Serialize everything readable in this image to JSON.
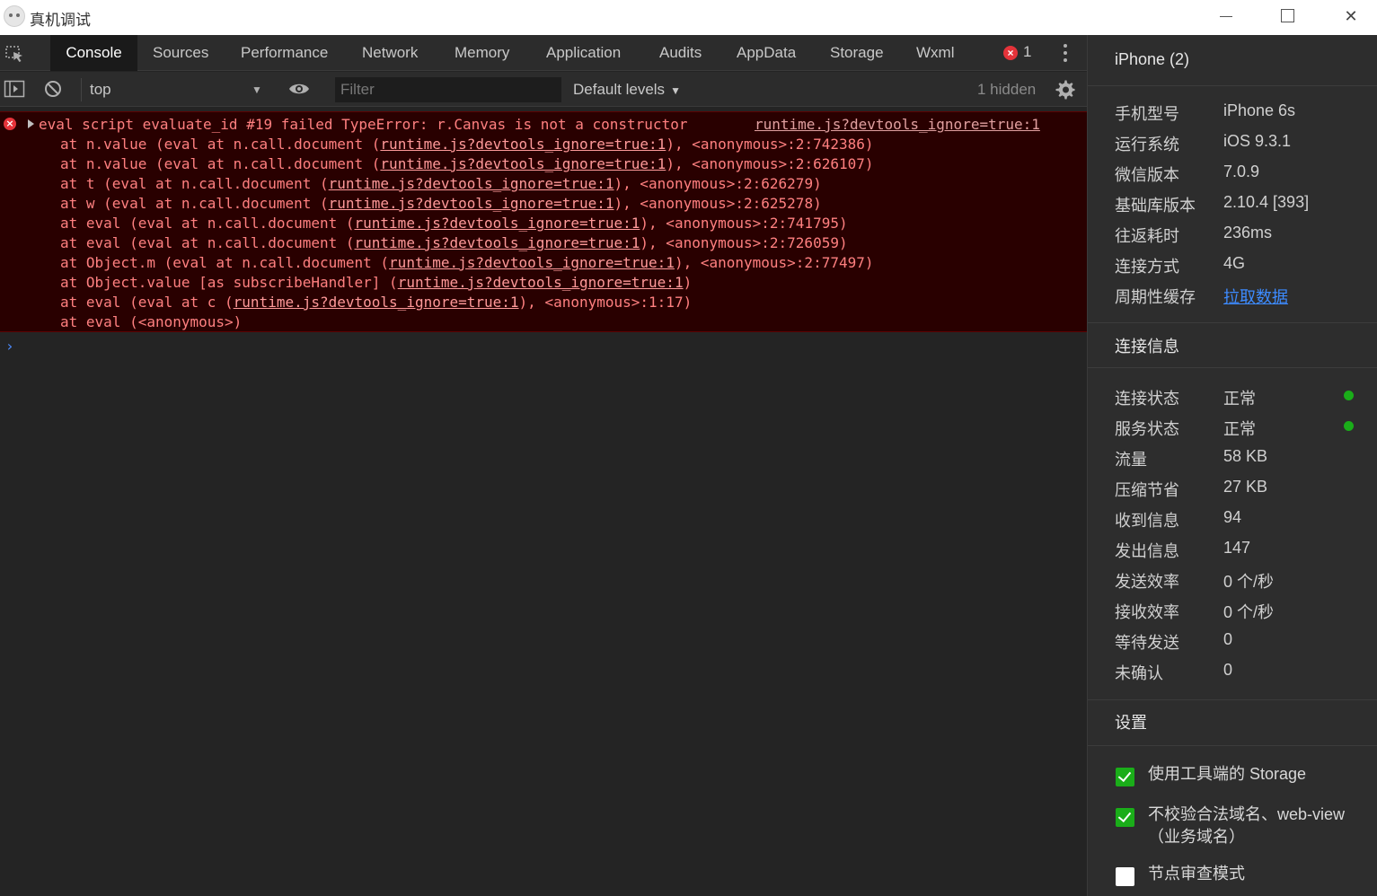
{
  "window": {
    "title": "真机调试",
    "minimize_icon": "minimize-icon",
    "maximize_icon": "maximize-icon",
    "close_glyph": "✕"
  },
  "tabs": [
    {
      "label": "Console",
      "active": true
    },
    {
      "label": "Sources"
    },
    {
      "label": "Performance"
    },
    {
      "label": "Network"
    },
    {
      "label": "Memory"
    },
    {
      "label": "Application"
    },
    {
      "label": "Audits"
    },
    {
      "label": "AppData"
    },
    {
      "label": "Storage"
    },
    {
      "label": "Wxml"
    }
  ],
  "error_badge": {
    "glyph": "×",
    "count": "1"
  },
  "toolbar": {
    "context": "top",
    "filter_placeholder": "Filter",
    "levels": "Default levels",
    "hidden": "1 hidden"
  },
  "console": {
    "error": {
      "icon_glyph": "×",
      "message": "eval script evaluate_id #19 failed TypeError: r.Canvas is not a constructor",
      "source": "runtime.js?devtools_ignore=true:1",
      "stack": [
        {
          "pre": "at n.value (eval at n.call.document (",
          "link": "runtime.js?devtools_ignore=true:1",
          "post": "), <anonymous>:2:742386)"
        },
        {
          "pre": "at n.value (eval at n.call.document (",
          "link": "runtime.js?devtools_ignore=true:1",
          "post": "), <anonymous>:2:626107)"
        },
        {
          "pre": "at t (eval at n.call.document (",
          "link": "runtime.js?devtools_ignore=true:1",
          "post": "), <anonymous>:2:626279)"
        },
        {
          "pre": "at w (eval at n.call.document (",
          "link": "runtime.js?devtools_ignore=true:1",
          "post": "), <anonymous>:2:625278)"
        },
        {
          "pre": "at eval (eval at n.call.document (",
          "link": "runtime.js?devtools_ignore=true:1",
          "post": "), <anonymous>:2:741795)"
        },
        {
          "pre": "at eval (eval at n.call.document (",
          "link": "runtime.js?devtools_ignore=true:1",
          "post": "), <anonymous>:2:726059)"
        },
        {
          "pre": "at Object.m (eval at n.call.document (",
          "link": "runtime.js?devtools_ignore=true:1",
          "post": "), <anonymous>:2:77497)"
        },
        {
          "pre": "at Object.value [as subscribeHandler] (",
          "link": "runtime.js?devtools_ignore=true:1",
          "post": ")"
        },
        {
          "pre": "at eval (eval at c (",
          "link": "runtime.js?devtools_ignore=true:1",
          "post": "), <anonymous>:1:17)"
        },
        {
          "pre": "at eval (<anonymous>)",
          "link": "",
          "post": ""
        }
      ]
    },
    "prompt": "›"
  },
  "side": {
    "device": "iPhone (2)",
    "info": [
      {
        "label": "手机型号",
        "value": "iPhone 6s"
      },
      {
        "label": "运行系统",
        "value": "iOS 9.3.1"
      },
      {
        "label": "微信版本",
        "value": "7.0.9"
      },
      {
        "label": "基础库版本",
        "value": "2.10.4 [393]"
      },
      {
        "label": "往返耗时",
        "value": "236ms"
      },
      {
        "label": "连接方式",
        "value": "4G"
      },
      {
        "label": "周期性缓存",
        "value": "拉取数据",
        "link": true
      }
    ],
    "conn_title": "连接信息",
    "conn": [
      {
        "label": "连接状态",
        "value": "正常",
        "status_dot": true
      },
      {
        "label": "服务状态",
        "value": "正常",
        "status_dot": true
      },
      {
        "label": "流量",
        "value": "58 KB"
      },
      {
        "label": "压缩节省",
        "value": "27 KB"
      },
      {
        "label": "收到信息",
        "value": "94"
      },
      {
        "label": "发出信息",
        "value": "147"
      },
      {
        "label": "发送效率",
        "value": "0 个/秒"
      },
      {
        "label": "接收效率",
        "value": "0 个/秒"
      },
      {
        "label": "等待发送",
        "value": "0"
      },
      {
        "label": "未确认",
        "value": "0"
      }
    ],
    "settings_title": "设置",
    "settings": [
      {
        "label": "使用工具端的 Storage",
        "checked": true
      },
      {
        "label": "不校验合法域名、web-view（业务域名）",
        "checked": true
      },
      {
        "label": "节点审查模式",
        "checked": false
      }
    ]
  },
  "colors": {
    "accent_green": "#1aad19",
    "link_blue": "#3d8bff",
    "error_red": "#e5333a",
    "error_bg": "#290000"
  }
}
